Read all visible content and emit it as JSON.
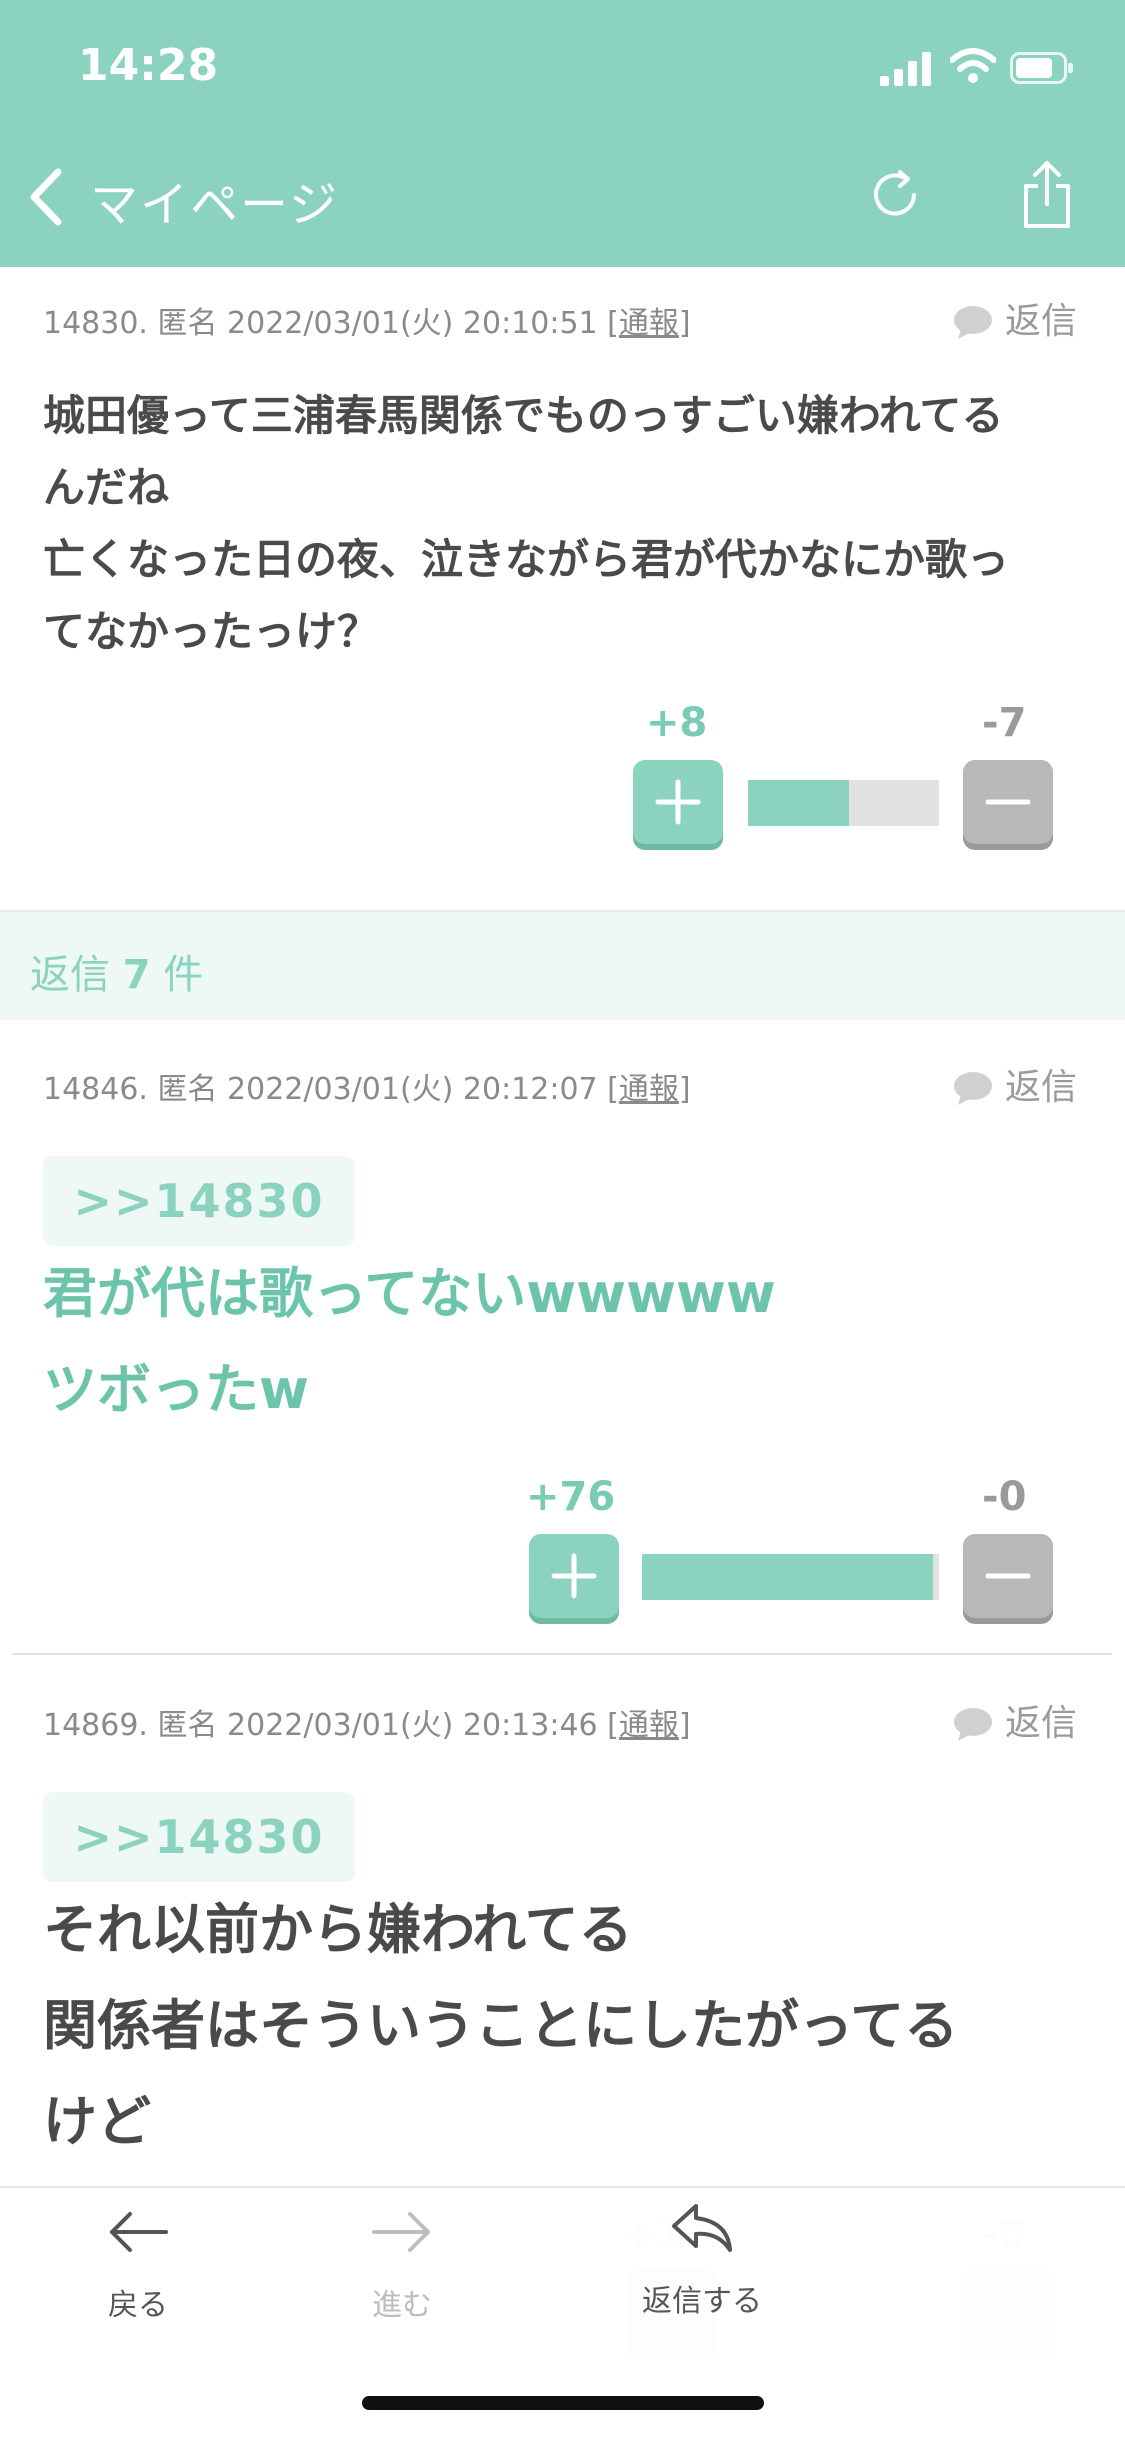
{
  "status_bar": {
    "time": "14:28"
  },
  "nav": {
    "title": "マイページ"
  },
  "main_post": {
    "meta_prefix": "14830. 匿名 2022/03/01(火) 20:10:51 [",
    "report_label": "通報",
    "meta_suffix": "]",
    "reply_label": "返信",
    "lines": [
      "城田優って三浦春馬関係でものっすごい嫌われてる",
      "んだね",
      "亡くなった日の夜、泣きながら君が代かなにか歌っ",
      "てなかったっけ？"
    ],
    "plus_count": "+8",
    "minus_count": "-7",
    "plus_ratio": 0.53
  },
  "replies_header": {
    "prefix": "返信 ",
    "count": "7",
    "suffix": " 件"
  },
  "reply1": {
    "meta_prefix": "14846. 匿名 2022/03/01(火) 20:12:07 [",
    "report_label": "通報",
    "meta_suffix": "]",
    "reply_label": "返信",
    "anchor": ">>14830",
    "lines": [
      "君が代は歌ってないwwwww",
      "ツボったw"
    ],
    "plus_count": "+76",
    "minus_count": "-0",
    "plus_ratio": 0.98
  },
  "reply2": {
    "meta_prefix": "14869. 匿名 2022/03/01(火) 20:13:46 [",
    "report_label": "通報",
    "meta_suffix": "]",
    "reply_label": "返信",
    "anchor": ">>14830",
    "lines": [
      "それ以前から嫌われてる",
      "関係者はそういうことにしたがってる",
      "けど"
    ],
    "plus_count_partial": "+1",
    "minus_count": "-0"
  },
  "toolbar": {
    "back_label": "戻る",
    "forward_label": "進む",
    "reply_label": "返信する"
  },
  "colors": {
    "accent": "#8bd3bf",
    "accent_text": "#6cc5aa",
    "minus": "#b8b8b8",
    "text": "#4a4a4a"
  },
  "icons": [
    "chevron-left-icon",
    "refresh-icon",
    "share-icon",
    "speech-bubble-icon",
    "plus-icon",
    "minus-icon",
    "arrow-left-icon",
    "arrow-right-icon",
    "reply-icon"
  ]
}
